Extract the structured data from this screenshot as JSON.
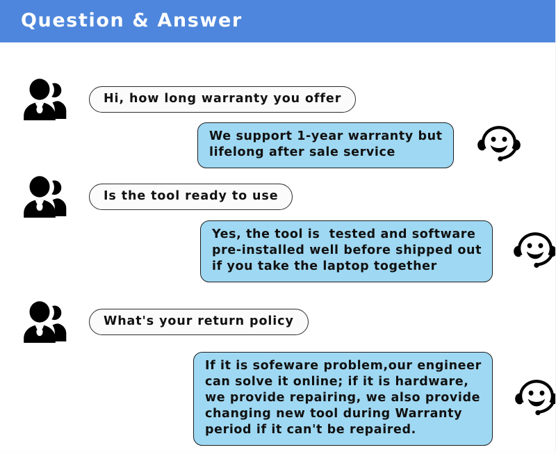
{
  "header": {
    "title": "Question & Answer",
    "background_color": "#4d86dc",
    "text_color": "#ffffff"
  },
  "colors": {
    "header_blue": "#4d86dc",
    "answer_bubble_fill": "#9fd8f2",
    "question_bubble_fill": "#fbfbfb",
    "bubble_border": "#1d1d1d",
    "icon_black": "#000000",
    "page_background": "#ffffff"
  },
  "icons": {
    "user_icon": "users-icon",
    "agent_icon": "headset-smiley-icon"
  },
  "conversation": [
    {
      "role": "question",
      "speaker": "customer",
      "text": "Hi, how long warranty you offer"
    },
    {
      "role": "answer",
      "speaker": "support-agent",
      "text": "We support 1-year warranty but\nlifelong after sale service"
    },
    {
      "role": "question",
      "speaker": "customer",
      "text": "Is the tool ready to use"
    },
    {
      "role": "answer",
      "speaker": "support-agent",
      "text": "Yes, the tool is  tested and software\npre-installed well before shipped out\nif you take the laptop together"
    },
    {
      "role": "question",
      "speaker": "customer",
      "text": "What's your return policy"
    },
    {
      "role": "answer",
      "speaker": "support-agent",
      "text": "If it is sofeware problem,our engineer\ncan solve it online; if it is hardware,\nwe provide repairing, we also provide\nchanging new tool during Warranty\nperiod if it can't be repaired."
    }
  ]
}
